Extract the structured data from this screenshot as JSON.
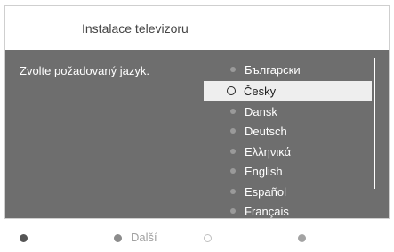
{
  "header": {
    "title": "Instalace televizoru"
  },
  "main": {
    "prompt": "Zvolte požadovaný jazyk.",
    "languages": [
      {
        "label": "Български",
        "selected": false
      },
      {
        "label": "Česky",
        "selected": true
      },
      {
        "label": "Dansk",
        "selected": false
      },
      {
        "label": "Deutsch",
        "selected": false
      },
      {
        "label": "Ελληνικά",
        "selected": false
      },
      {
        "label": "English",
        "selected": false
      },
      {
        "label": "Español",
        "selected": false
      },
      {
        "label": "Français",
        "selected": false
      }
    ]
  },
  "footer": {
    "next_label": "Další",
    "colors": {
      "red": "#555555",
      "green": "#8c8c8c",
      "yellow": "#cfcfcf",
      "blue": "#a3a3a3"
    }
  }
}
